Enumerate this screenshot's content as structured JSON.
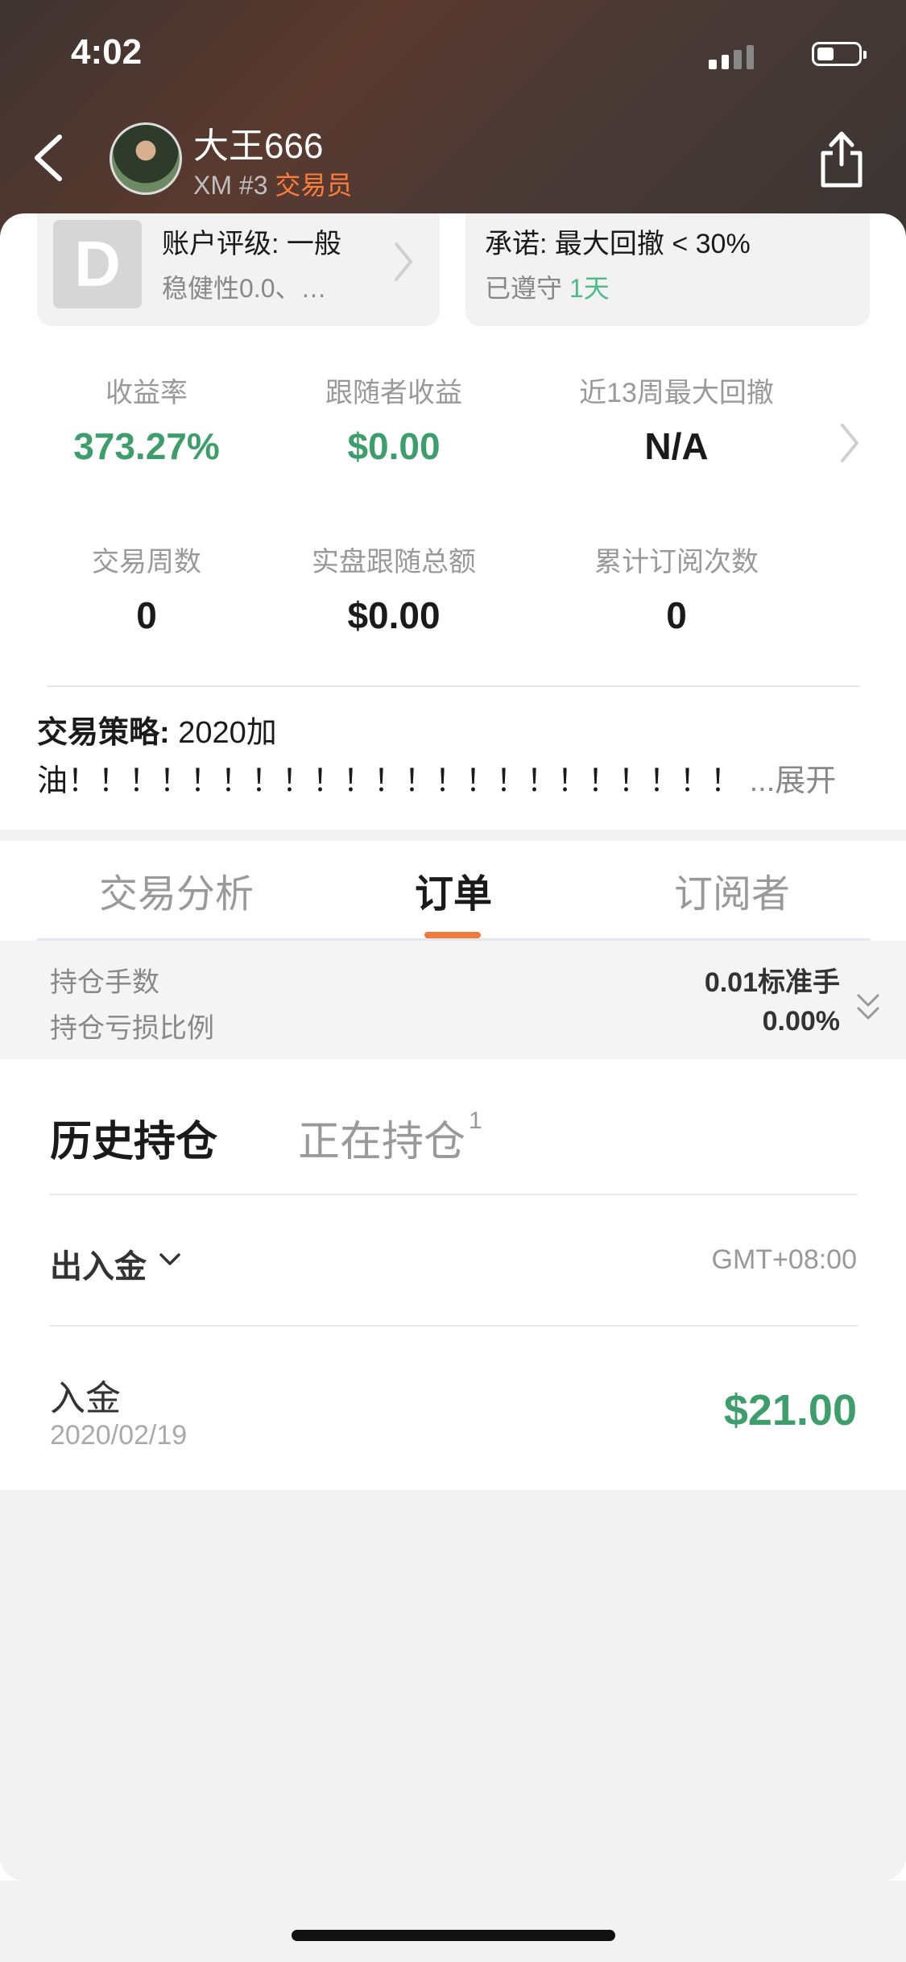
{
  "status_bar": {
    "time": "4:02"
  },
  "header": {
    "trader_name": "大王666",
    "broker_rank": "XM #3",
    "role": "交易员"
  },
  "rating": {
    "grade": "D",
    "title": "账户评级: 一般",
    "subtitle": "稳健性0.0、…"
  },
  "promise": {
    "title": "承诺: 最大回撤 < 30%",
    "complied_label": "已遵守",
    "complied_days": "1天"
  },
  "stats": [
    {
      "label": "收益率",
      "value": "373.27%"
    },
    {
      "label": "跟随者收益",
      "value": "$0.00"
    },
    {
      "label": "近13周最大回撤",
      "value": "N/A"
    },
    {
      "label": "交易周数",
      "value": "0"
    },
    {
      "label": "实盘跟随总额",
      "value": "$0.00"
    },
    {
      "label": "累计订阅次数",
      "value": "0"
    }
  ],
  "strategy": {
    "label": "交易策略:",
    "text_line1": "2020加",
    "text_line2": "油！！！！！！！！！！！！！！！！！！！！！！",
    "expand": "...展开"
  },
  "tabs": [
    {
      "label": "交易分析"
    },
    {
      "label": "订单"
    },
    {
      "label": "订阅者"
    }
  ],
  "summary": {
    "lots_label": "持仓手数",
    "lots_value": "0.01标准手",
    "pl_ratio_label": "持仓亏损比例",
    "pl_ratio_value": "0.00%"
  },
  "positions": {
    "history_label": "历史持仓",
    "open_label": "正在持仓",
    "open_count": "1"
  },
  "filter": {
    "label": "出入金",
    "timezone": "GMT+08:00"
  },
  "transactions": [
    {
      "type": "入金",
      "date": "2020/02/19",
      "amount": "$21.00"
    }
  ],
  "colors": {
    "positive_green": "#3d9e6c",
    "accent_orange": "#f07a3c",
    "role_orange": "#ff7c3a"
  }
}
